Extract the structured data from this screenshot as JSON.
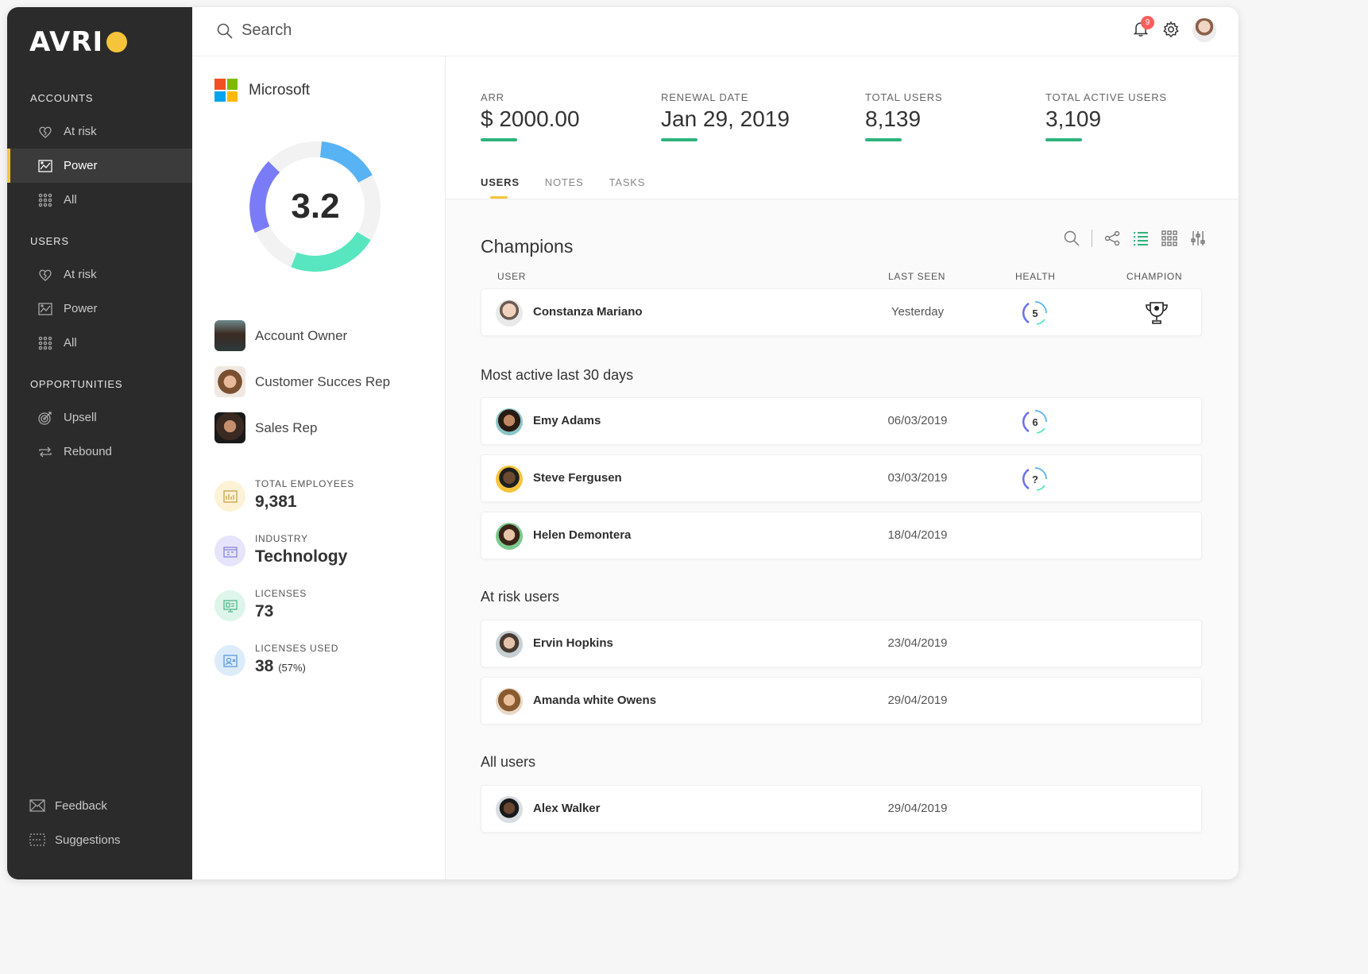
{
  "brand": {
    "logo_text": "AVRI",
    "accent": "#f5c43a"
  },
  "sidebar": {
    "sections": [
      {
        "title": "ACCOUNTS",
        "items": [
          {
            "label": "At risk",
            "icon": "broken-heart-icon",
            "active": false
          },
          {
            "label": "Power",
            "icon": "chart-image-icon",
            "active": true
          },
          {
            "label": "All",
            "icon": "grid-dots-icon",
            "active": false
          }
        ]
      },
      {
        "title": "USERS",
        "items": [
          {
            "label": "At risk",
            "icon": "broken-heart-icon",
            "active": false
          },
          {
            "label": "Power",
            "icon": "chart-image-icon",
            "active": false
          },
          {
            "label": "All",
            "icon": "grid-dots-icon",
            "active": false
          }
        ]
      },
      {
        "title": "OPPORTUNITIES",
        "items": [
          {
            "label": "Upsell",
            "icon": "target-icon",
            "active": false
          },
          {
            "label": "Rebound",
            "icon": "repeat-icon",
            "active": false
          }
        ]
      }
    ],
    "bottom": [
      {
        "label": "Feedback",
        "icon": "mail-icon"
      },
      {
        "label": "Suggestions",
        "icon": "dashed-box-icon"
      }
    ]
  },
  "topbar": {
    "search_placeholder": "Search",
    "notification_count": "9"
  },
  "account": {
    "name": "Microsoft",
    "score": "3.2",
    "team": [
      {
        "role": "Account Owner"
      },
      {
        "role": "Customer Succes Rep"
      },
      {
        "role": "Sales Rep"
      }
    ],
    "stats": [
      {
        "label": "TOTAL EMPLOYEES",
        "value": "9,381",
        "extra": ""
      },
      {
        "label": "INDUSTRY",
        "value": "Technology",
        "extra": ""
      },
      {
        "label": "LICENSES",
        "value": "73",
        "extra": ""
      },
      {
        "label": "LICENSES USED",
        "value": "38",
        "extra": "(57%)"
      }
    ]
  },
  "kpis": [
    {
      "label": "ARR",
      "value": "$ 2000.00"
    },
    {
      "label": "RENEWAL DATE",
      "value": "Jan 29, 2019"
    },
    {
      "label": "TOTAL USERS",
      "value": "8,139"
    },
    {
      "label": "TOTAL ACTIVE USERS",
      "value": "3,109"
    }
  ],
  "tabs": [
    {
      "label": "USERS",
      "active": true
    },
    {
      "label": "NOTES",
      "active": false
    },
    {
      "label": "TASKS",
      "active": false
    }
  ],
  "table": {
    "columns": {
      "user": "USER",
      "last_seen": "LAST SEEN",
      "health": "HEALTH",
      "champion": "CHAMPION"
    }
  },
  "groups": {
    "champions": {
      "title": "Champions",
      "rows": [
        {
          "name": "Constanza Mariano",
          "last_seen": "Yesterday",
          "health": "5",
          "champion": true
        }
      ]
    },
    "most_active": {
      "title": "Most active last 30 days",
      "rows": [
        {
          "name": "Emy Adams",
          "last_seen": "06/03/2019",
          "health": "6"
        },
        {
          "name": "Steve Fergusen",
          "last_seen": "03/03/2019",
          "health": "?"
        },
        {
          "name": "Helen Demontera",
          "last_seen": "18/04/2019",
          "health": ""
        }
      ]
    },
    "at_risk": {
      "title": "At risk users",
      "rows": [
        {
          "name": "Ervin Hopkins",
          "last_seen": "23/04/2019",
          "health": ""
        },
        {
          "name": "Amanda white Owens",
          "last_seen": "29/04/2019",
          "health": ""
        }
      ]
    },
    "all": {
      "title": "All users",
      "rows": [
        {
          "name": "Alex Walker",
          "last_seen": "29/04/2019",
          "health": ""
        }
      ]
    }
  }
}
